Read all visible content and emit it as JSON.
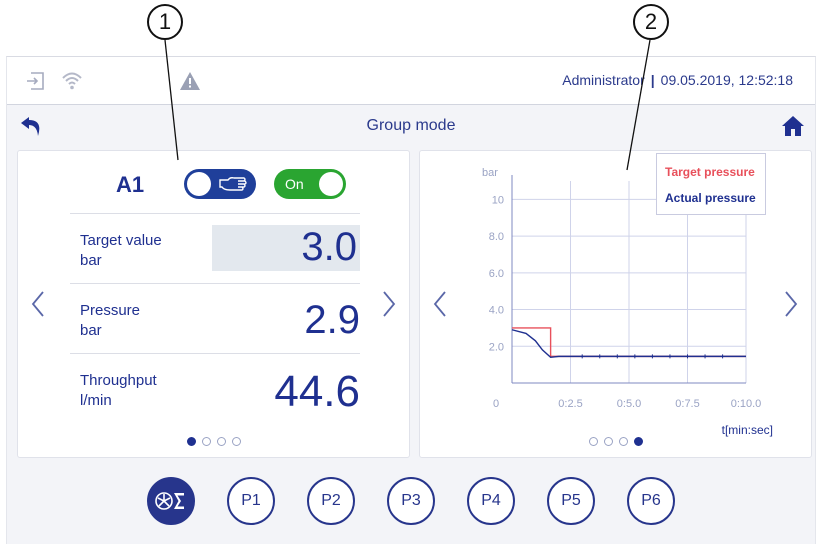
{
  "callouts": [
    "1",
    "2"
  ],
  "status": {
    "user": "Administrator",
    "separator": "|",
    "datetime": "09.05.2019, 12:52:18"
  },
  "title": "Group mode",
  "channel": {
    "label": "A1",
    "mode_toggle": "manual",
    "power_label": "On",
    "rows": [
      {
        "label1": "Target value",
        "label2": "bar",
        "value": "3.0"
      },
      {
        "label1": "Pressure",
        "label2": "bar",
        "value": "2.9"
      },
      {
        "label1": "Throughput",
        "label2": "l/min",
        "value": "44.6"
      }
    ],
    "page": {
      "count": 4,
      "active": 0
    }
  },
  "chart_data": {
    "type": "line",
    "ylabel": "bar",
    "xlabel": "t[min:sec]",
    "y_ticks": [
      "10",
      "8.0",
      "6.0",
      "4.0",
      "2.0"
    ],
    "y_tick_values": [
      10,
      8,
      6,
      4,
      2
    ],
    "x_ticks": [
      "0",
      "0:2.5",
      "0:5.0",
      "0:7.5",
      "0:10.0"
    ],
    "x_tick_values": [
      0,
      2.5,
      5.0,
      7.5,
      10.0
    ],
    "ylim": [
      0,
      11
    ],
    "xlim": [
      0,
      10.0
    ],
    "grid": true,
    "legend_placement": "top-right",
    "series": [
      {
        "name": "Target pressure",
        "color": "#e8505b",
        "x": [
          0,
          1.65,
          1.65,
          10.0
        ],
        "y": [
          3.0,
          3.0,
          1.45,
          1.45
        ]
      },
      {
        "name": "Actual pressure",
        "color": "#1f3090",
        "x": [
          0,
          0.6,
          1.0,
          1.3,
          1.65,
          2.0,
          10.0
        ],
        "y": [
          2.9,
          2.7,
          2.3,
          1.8,
          1.4,
          1.45,
          1.45
        ]
      }
    ],
    "page": {
      "count": 4,
      "active": 3
    }
  },
  "programs": [
    "P1",
    "P2",
    "P3",
    "P4",
    "P5",
    "P6"
  ],
  "colors": {
    "accent": "#1f3090",
    "on": "#2aa531",
    "warning": "#9aa0b4"
  }
}
